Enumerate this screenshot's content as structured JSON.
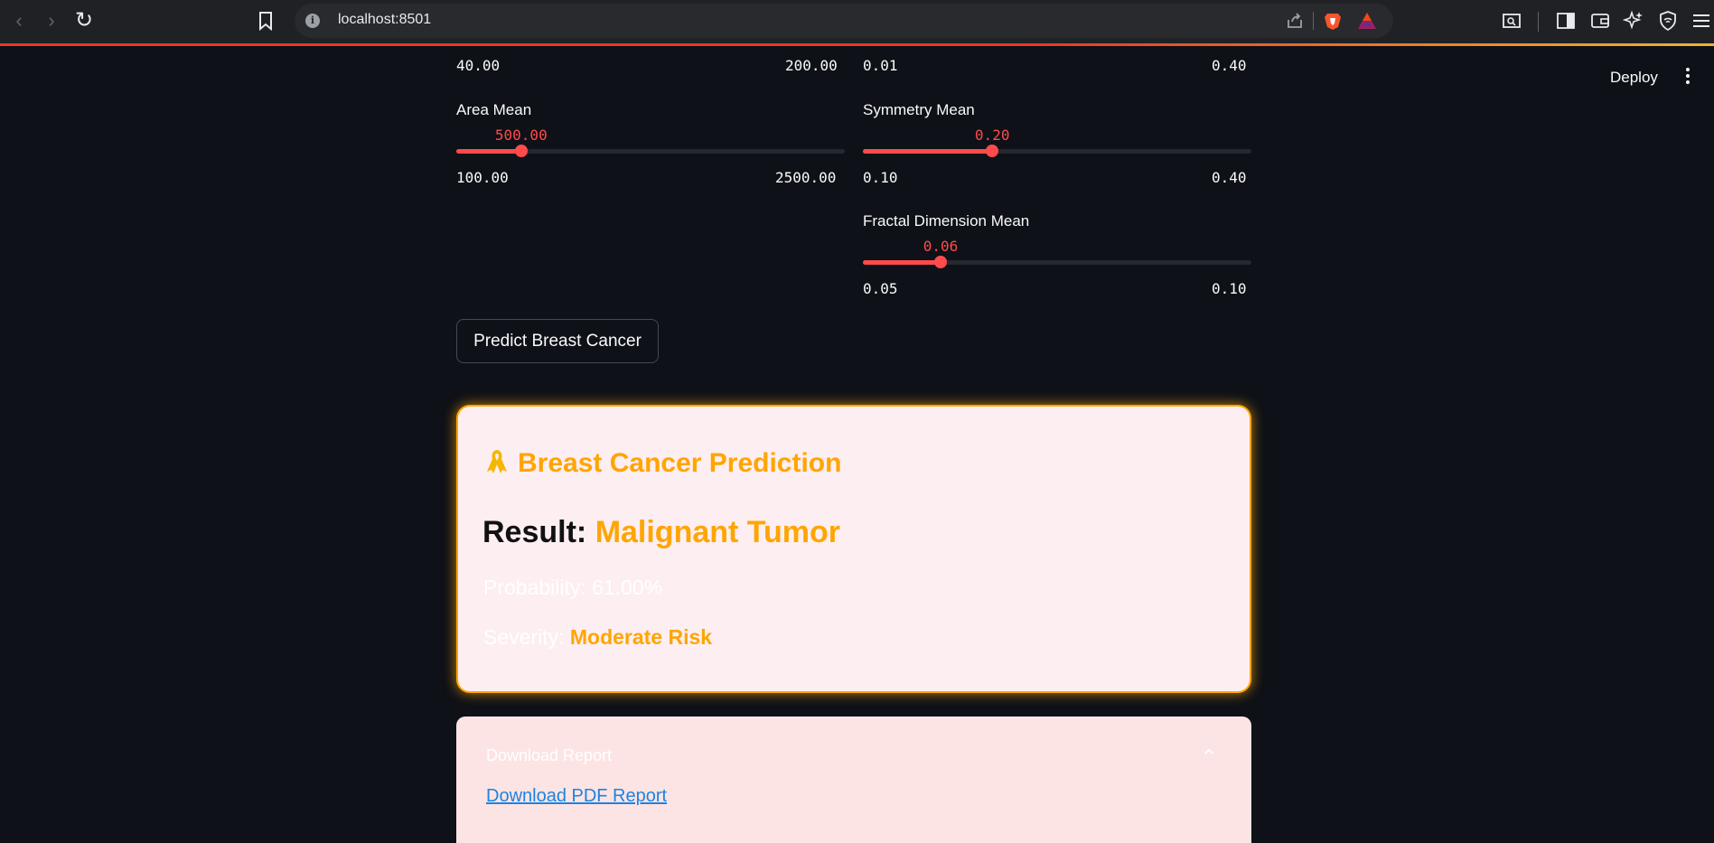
{
  "browser": {
    "url": "localhost:8501"
  },
  "header": {
    "deploy_label": "Deploy"
  },
  "sliders_top_row": [
    {
      "min": "40.00",
      "max": "200.00"
    },
    {
      "min": "0.01",
      "max": "0.40"
    }
  ],
  "sliders": [
    {
      "label": "Area Mean",
      "value": "500.00",
      "min": "100.00",
      "max": "2500.00",
      "fraction": 0.167
    },
    {
      "label": "Symmetry Mean",
      "value": "0.20",
      "min": "0.10",
      "max": "0.40",
      "fraction": 0.333
    },
    {
      "label": "Fractal Dimension Mean",
      "value": "0.06",
      "min": "0.05",
      "max": "0.10",
      "fraction": 0.2
    }
  ],
  "predict_button": "Predict Breast Cancer",
  "result_card": {
    "title": "Breast Cancer Prediction",
    "ribbon_icon": "ribbon-icon",
    "result_label": "Result:",
    "result_value": "Malignant Tumor",
    "probability_text": "Probability: 61.00%",
    "severity_label": "Severity:",
    "severity_value": "Moderate Risk"
  },
  "download": {
    "title": "Download Report",
    "link": "Download PDF Report"
  },
  "colors": {
    "accent": "#ff4b4b",
    "warning": "#ffa500",
    "link": "#1c83e1",
    "background": "#0e1117"
  }
}
